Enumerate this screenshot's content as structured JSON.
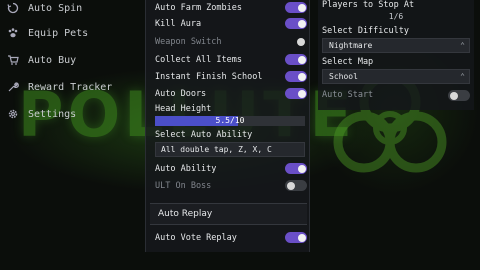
{
  "background": {
    "word": "POLLUTE"
  },
  "sidebar": {
    "items": [
      {
        "label": "Auto Spin",
        "icon": "spin-icon"
      },
      {
        "label": "Equip Pets",
        "icon": "paw-icon"
      },
      {
        "label": "Auto Buy",
        "icon": "cart-icon"
      },
      {
        "label": "Reward Tracker",
        "icon": "wrench-icon"
      },
      {
        "label": "Settings",
        "icon": "gear-icon"
      }
    ]
  },
  "panel": {
    "auto_farm_zombies": {
      "label": "Auto Farm Zombies",
      "on": true
    },
    "kill_aura": {
      "label": "Kill Aura",
      "on": true
    },
    "weapon_switch": {
      "label": "Weapon Switch",
      "on": false
    },
    "collect_all_items": {
      "label": "Collect All Items",
      "on": true
    },
    "instant_finish_school": {
      "label": "Instant Finish School",
      "on": true
    },
    "auto_doors": {
      "label": "Auto Doors",
      "on": true
    },
    "head_height": {
      "label": "Head Height",
      "value_text": "5.5/10",
      "value": 5.5,
      "max": 10
    },
    "select_auto_ability": {
      "label": "Select Auto Ability",
      "value": "All double tap, Z, X, C"
    },
    "auto_ability": {
      "label": "Auto Ability",
      "on": true
    },
    "ult_on_boss": {
      "label": "ULT On Boss",
      "on": false
    },
    "auto_replay_section": "Auto Replay",
    "auto_vote_replay": {
      "label": "Auto Vote Replay",
      "on": true
    }
  },
  "right": {
    "players_to_stop": {
      "label": "Players to Stop At",
      "value": "1/6"
    },
    "select_difficulty": {
      "label": "Select Difficulty",
      "value": "Nightmare"
    },
    "select_map": {
      "label": "Select Map",
      "value": "School"
    },
    "auto_start": {
      "label": "Auto Start",
      "on": false
    }
  },
  "colors": {
    "toggle_on": "#6a4fc7",
    "slider_fill": "#4b4fc8",
    "accent_green": "#3f8f1e"
  }
}
